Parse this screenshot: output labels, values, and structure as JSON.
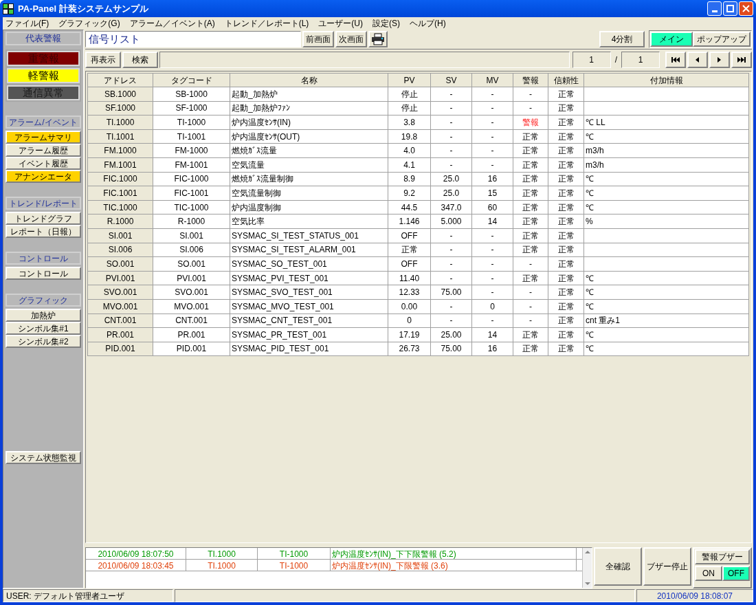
{
  "window": {
    "title": "PA-Panel 計装システムサンプル"
  },
  "menu": [
    "ファイル(F)",
    "グラフィック(G)",
    "アラーム／イベント(A)",
    "トレンド／レポート(L)",
    "ユーザー(U)",
    "設定(S)",
    "ヘルプ(H)"
  ],
  "sidebar": {
    "header": "代表警報",
    "indicators": [
      {
        "label": "重警報",
        "kind": "major"
      },
      {
        "label": "軽警報",
        "kind": "minor"
      },
      {
        "label": "通信異常",
        "kind": "comm"
      }
    ],
    "groups": [
      {
        "title": "アラーム/イベント",
        "items": [
          {
            "label": "アラームサマリ",
            "alert": true
          },
          {
            "label": "アラーム履歴",
            "alert": false
          },
          {
            "label": "イベント履歴",
            "alert": false
          },
          {
            "label": "アナンシエータ",
            "alert": true
          }
        ]
      },
      {
        "title": "トレンド/レポート",
        "items": [
          {
            "label": "トレンドグラフ",
            "alert": false
          },
          {
            "label": "レポート（日報）",
            "alert": false
          }
        ]
      },
      {
        "title": "コントロール",
        "items": [
          {
            "label": "コントロール",
            "alert": false
          }
        ]
      },
      {
        "title": "グラフィック",
        "items": [
          {
            "label": "加熱炉",
            "alert": false
          },
          {
            "label": "シンボル集#1",
            "alert": false
          },
          {
            "label": "シンボル集#2",
            "alert": false
          }
        ]
      }
    ],
    "footer_button": "システム状態監視"
  },
  "screen_title": "信号リスト",
  "nav_buttons": [
    "前画面",
    "次画面"
  ],
  "split_button": "4分割",
  "display_modes": [
    {
      "label": "メイン",
      "selected": true
    },
    {
      "label": "ポップアップ",
      "selected": false
    }
  ],
  "toolbar_buttons": [
    "再表示",
    "検索"
  ],
  "pager": {
    "current": "1",
    "separator": "/",
    "total": "1"
  },
  "table": {
    "columns": [
      "アドレス",
      "タグコード",
      "名称",
      "PV",
      "SV",
      "MV",
      "警報",
      "信頼性",
      "付加情報"
    ],
    "rows": [
      {
        "cells": [
          "SB.1000",
          "SB-1000",
          "起動_加熱炉",
          "停止",
          "-",
          "-",
          "-",
          "正常"
        ],
        "alarm": false
      },
      {
        "cells": [
          "SF.1000",
          "SF-1000",
          "起動_加熱炉ﾌｧﾝ",
          "停止",
          "-",
          "-",
          "-",
          "正常"
        ],
        "alarm": false
      },
      {
        "cells": [
          "TI.1000",
          "TI-1000",
          "炉内温度ｾﾝｻ(IN)",
          "3.8",
          "-",
          "-",
          "警報",
          "正常",
          "℃ LL"
        ],
        "alarm": true
      },
      {
        "cells": [
          "TI.1001",
          "TI-1001",
          "炉内温度ｾﾝｻ(OUT)",
          "19.8",
          "-",
          "-",
          "正常",
          "正常",
          "℃"
        ],
        "alarm": false
      },
      {
        "cells": [
          "FM.1000",
          "FM-1000",
          "燃焼ｶﾞｽ流量",
          "4.0",
          "-",
          "-",
          "正常",
          "正常",
          "m3/h"
        ],
        "alarm": false
      },
      {
        "cells": [
          "FM.1001",
          "FM-1001",
          "空気流量",
          "4.1",
          "-",
          "-",
          "正常",
          "正常",
          "m3/h"
        ],
        "alarm": false
      },
      {
        "cells": [
          "FIC.1000",
          "FIC-1000",
          "燃焼ｶﾞｽ流量制御",
          "8.9",
          "25.0",
          "16",
          "正常",
          "正常",
          "℃"
        ],
        "alarm": false
      },
      {
        "cells": [
          "FIC.1001",
          "FIC-1001",
          "空気流量制御",
          "9.2",
          "25.0",
          "15",
          "正常",
          "正常",
          "℃"
        ],
        "alarm": false
      },
      {
        "cells": [
          "TIC.1000",
          "TIC-1000",
          "炉内温度制御",
          "44.5",
          "347.0",
          "60",
          "正常",
          "正常",
          "℃"
        ],
        "alarm": false
      },
      {
        "cells": [
          "R.1000",
          "R-1000",
          "空気比率",
          "1.146",
          "5.000",
          "14",
          "正常",
          "正常",
          "%"
        ],
        "alarm": false
      },
      {
        "cells": [
          "SI.001",
          "SI.001",
          "SYSMAC_SI_TEST_STATUS_001",
          "OFF",
          "-",
          "-",
          "正常",
          "正常"
        ],
        "alarm": false
      },
      {
        "cells": [
          "SI.006",
          "SI.006",
          "SYSMAC_SI_TEST_ALARM_001",
          "正常",
          "-",
          "-",
          "正常",
          "正常"
        ],
        "alarm": false
      },
      {
        "cells": [
          "SO.001",
          "SO.001",
          "SYSMAC_SO_TEST_001",
          "OFF",
          "-",
          "-",
          "-",
          "正常"
        ],
        "alarm": false
      },
      {
        "cells": [
          "PVI.001",
          "PVI.001",
          "SYSMAC_PVI_TEST_001",
          "11.40",
          "-",
          "-",
          "正常",
          "正常",
          "℃"
        ],
        "alarm": false
      },
      {
        "cells": [
          "SVO.001",
          "SVO.001",
          "SYSMAC_SVO_TEST_001",
          "12.33",
          "75.00",
          "-",
          "-",
          "正常",
          "℃"
        ],
        "alarm": false
      },
      {
        "cells": [
          "MVO.001",
          "MVO.001",
          "SYSMAC_MVO_TEST_001",
          "0.00",
          "-",
          "0",
          "-",
          "正常",
          "℃"
        ],
        "alarm": false
      },
      {
        "cells": [
          "CNT.001",
          "CNT.001",
          "SYSMAC_CNT_TEST_001",
          "0",
          "-",
          "-",
          "-",
          "正常",
          "cnt 重み1"
        ],
        "alarm": false
      },
      {
        "cells": [
          "PR.001",
          "PR.001",
          "SYSMAC_PR_TEST_001",
          "17.19",
          "25.00",
          "14",
          "正常",
          "正常",
          "℃"
        ],
        "alarm": false
      },
      {
        "cells": [
          "PID.001",
          "PID.001",
          "SYSMAC_PID_TEST_001",
          "26.73",
          "75.00",
          "16",
          "正常",
          "正常",
          "℃"
        ],
        "alarm": false
      }
    ]
  },
  "event_log": [
    {
      "time": "2010/06/09 18:07:50",
      "address": "TI.1000",
      "tag": "TI-1000",
      "message": "炉内温度ｾﾝｻ(IN)_下下限警報 (5.2)",
      "color": "#009900"
    },
    {
      "time": "2010/06/09 18:03:45",
      "address": "TI.1000",
      "tag": "TI-1000",
      "message": "炉内温度ｾﾝｻ(IN)_下限警報 (3.6)",
      "color": "#e0400a"
    }
  ],
  "action_buttons": [
    "全確認",
    "ブザー停止"
  ],
  "buzzer": {
    "title": "警報ブザー",
    "options": [
      {
        "label": "ON",
        "selected": false
      },
      {
        "label": "OFF",
        "selected": true
      }
    ]
  },
  "status_bar": {
    "user": "USER: デフォルト管理者ユーザ",
    "datetime": "2010/06/09 18:08:07"
  }
}
